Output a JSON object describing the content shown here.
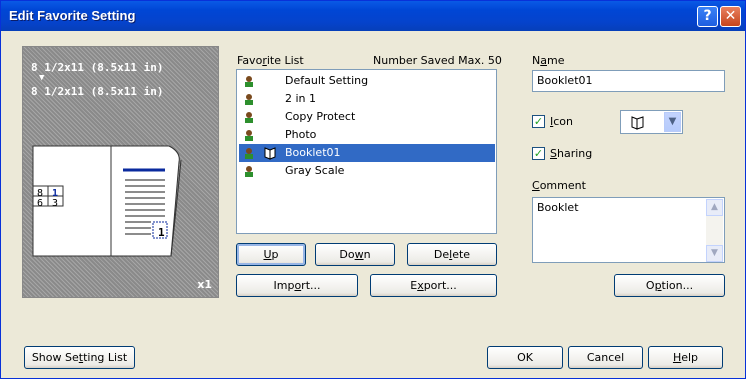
{
  "window": {
    "title": "Edit Favorite Setting",
    "help_label": "?",
    "close_label": "✕"
  },
  "preview": {
    "paper_line1": "8 1/2x11 (8.5x11 in)",
    "arrow": "▼",
    "paper_line2": "8 1/2x11 (8.5x11 in)",
    "copies": "x1",
    "page_labels": [
      "8",
      "1",
      "6",
      "3",
      "1"
    ]
  },
  "favorites": {
    "list_label": "Favorite List",
    "max_label": "Number Saved Max. 50",
    "items": [
      {
        "label": "Default Setting",
        "selected": false
      },
      {
        "label": "2 in 1",
        "selected": false
      },
      {
        "label": "Copy Protect",
        "selected": false
      },
      {
        "label": "Photo",
        "selected": false
      },
      {
        "label": "Booklet01",
        "selected": true
      },
      {
        "label": "Gray Scale",
        "selected": false
      }
    ],
    "up": "Up",
    "down": "Down",
    "delete": "Delete",
    "import": "Import...",
    "export": "Export..."
  },
  "details": {
    "name_label": "Name",
    "name_value": "Booklet01",
    "icon_label": "Icon",
    "icon_checked": true,
    "sharing_label": "Sharing",
    "sharing_checked": true,
    "comment_label": "Comment",
    "comment_value": "Booklet",
    "option": "Option..."
  },
  "footer": {
    "show_setting_list": "Show Setting List",
    "ok": "OK",
    "cancel": "Cancel",
    "help": "Help"
  }
}
